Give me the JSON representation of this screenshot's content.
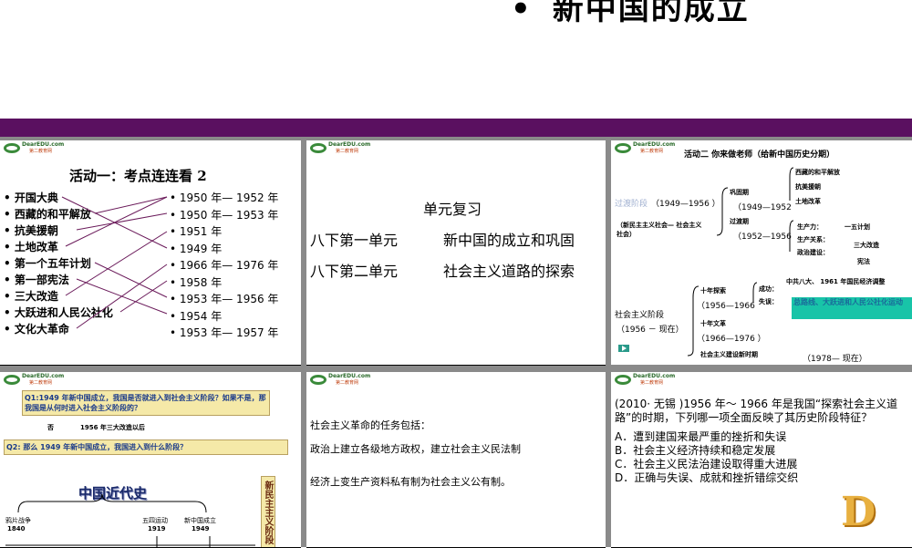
{
  "top": {
    "bullet": "•",
    "title": "新中国的成立"
  },
  "logo": {
    "brand": "DearEDU.com",
    "sub": "第二教育网"
  },
  "s1": {
    "title": "活动一：考点连连看 2",
    "left": [
      "开国大典",
      "西藏的和平解放",
      "抗美援朝",
      "土地改革",
      "第一个五年计划",
      "第一部宪法",
      "三大改造",
      "大跃进和人民公社化",
      "文化大革命"
    ],
    "right": [
      "1950 年— 1952 年",
      "1950 年— 1953 年",
      "1951 年",
      "1949 年",
      "1966 年— 1976 年",
      "1958 年",
      "1953 年— 1956 年",
      "1954 年",
      "1953 年— 1957 年"
    ]
  },
  "s2": {
    "heading": "单元复习",
    "rows": [
      {
        "unit": "八下第一单元",
        "topic": "新中国的成立和巩固"
      },
      {
        "unit": "八下第二单元",
        "topic": "社会主义道路的探索"
      }
    ]
  },
  "s3": {
    "title": "活动二  你来做老师（给新中国历史分期）",
    "stage1": "过渡阶段",
    "stage1_range": "（1949—1956 ）",
    "stage1_sub": "（新民主主义社会— 社会主义社会）",
    "gonggu": "巩固期",
    "gonggu_range": "（1949—1952",
    "guodu": "过渡期",
    "guodu_range": "（1952—1956",
    "g_items": [
      "西藏的和平解放",
      "抗美援朝",
      "土地改革"
    ],
    "shengchanli": "生产力：",
    "wuyi": "一五计划",
    "guanxi": "生产关系：",
    "sanda": "三大改造",
    "zhengzhi": "政治建设：",
    "xianfa": "宪法",
    "stage2": "社会主义阶段",
    "stage2_range": "（1956 － 现在）",
    "shinian": "十年探索",
    "shinian_range": "（1956—1966",
    "chenggong": "成功：",
    "cg_text": "中共八大、 1961 年国民经济调整",
    "shiwu": "失误：",
    "sw_text": "总路线、大跃进和人民公社化运动",
    "wenge": "十年文革",
    "wenge_range": "（1966—1976 ）",
    "xinshiqi": "社会主义建设新时期",
    "xin_range": "（1978— 现在）"
  },
  "s4": {
    "q1": "Q1:1949 年新中国成立，我国是否就进入到社会主义阶段？如果不是，那我国是从何时进入社会主义阶段的？",
    "a1": "否",
    "a1b": "1956 年三大改造以后",
    "q2": "Q2: 那么 1949 年新中国成立，我国进入到什么阶段？",
    "history_title": "中国近代史",
    "events": [
      {
        "name": "鸦片战争",
        "year": "1840"
      },
      {
        "name": "五四运动",
        "year": "1919"
      },
      {
        "name": "新中国成立",
        "year": "1949"
      }
    ],
    "side": "新民主主义阶段"
  },
  "s5": {
    "lines": [
      "社会主义革命的任务包括：",
      "政治上建立各级地方政权，建立社会主义民法制",
      "经济上变生产资料私有制为社会主义公有制。"
    ]
  },
  "s6": {
    "question": "(2010· 无锡 )1956 年～ 1966 年是我国“探索社会主义道路”的时期，下列哪一项全面反映了其历史阶段特征？",
    "options": [
      "A．遭到建国来最严重的挫折和失误",
      "B．社会主义经济持续和稳定发展",
      "C．社会主义民法治建设取得重大进展",
      "D．正确与失误、成就和挫折错综交织"
    ],
    "answer": "D"
  }
}
